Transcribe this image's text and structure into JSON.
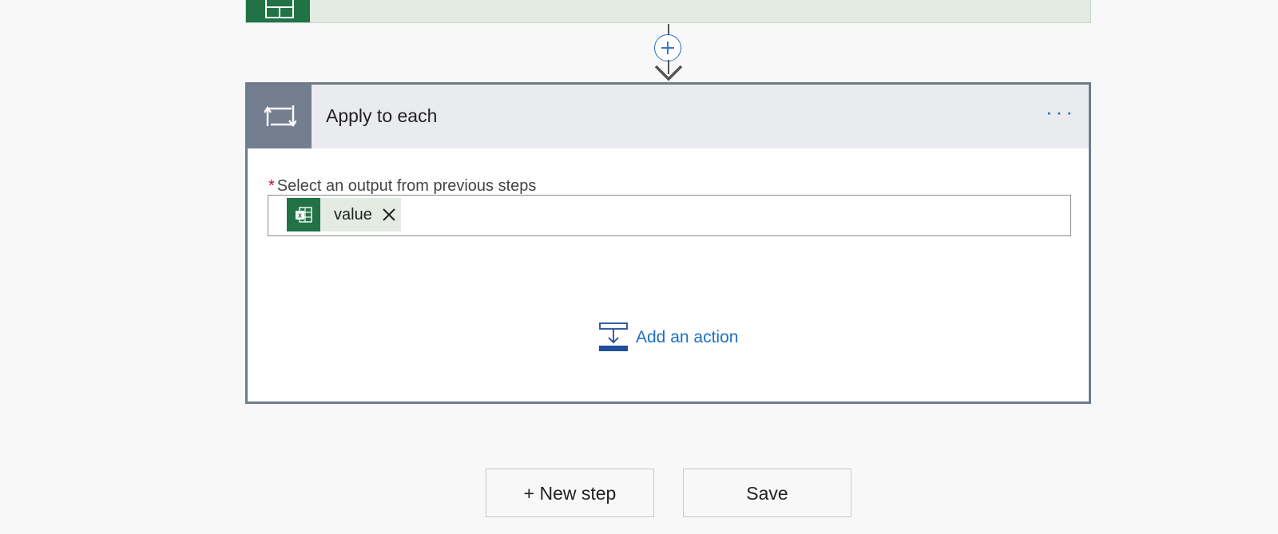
{
  "previous_step": {
    "icon": "excel-icon",
    "color": "#217346"
  },
  "connector": {
    "insert_icon": "plus-icon"
  },
  "apply_card": {
    "title": "Apply to each",
    "icon": "loop-icon",
    "menu_icon": "more-icon",
    "menu_label": "···",
    "field": {
      "required_mark": "*",
      "label": "Select an output from previous steps",
      "tokens": [
        {
          "label": "value",
          "icon": "excel-icon",
          "remove_icon": "close-icon"
        }
      ]
    },
    "add_action_label": "Add an action"
  },
  "footer": {
    "new_step_label": "+ New step",
    "save_label": "Save"
  },
  "colors": {
    "accent": "#1f6fc5",
    "excel_green": "#217346",
    "loop_header_icon_bg": "#737f8f",
    "required": "#c50f1f"
  }
}
